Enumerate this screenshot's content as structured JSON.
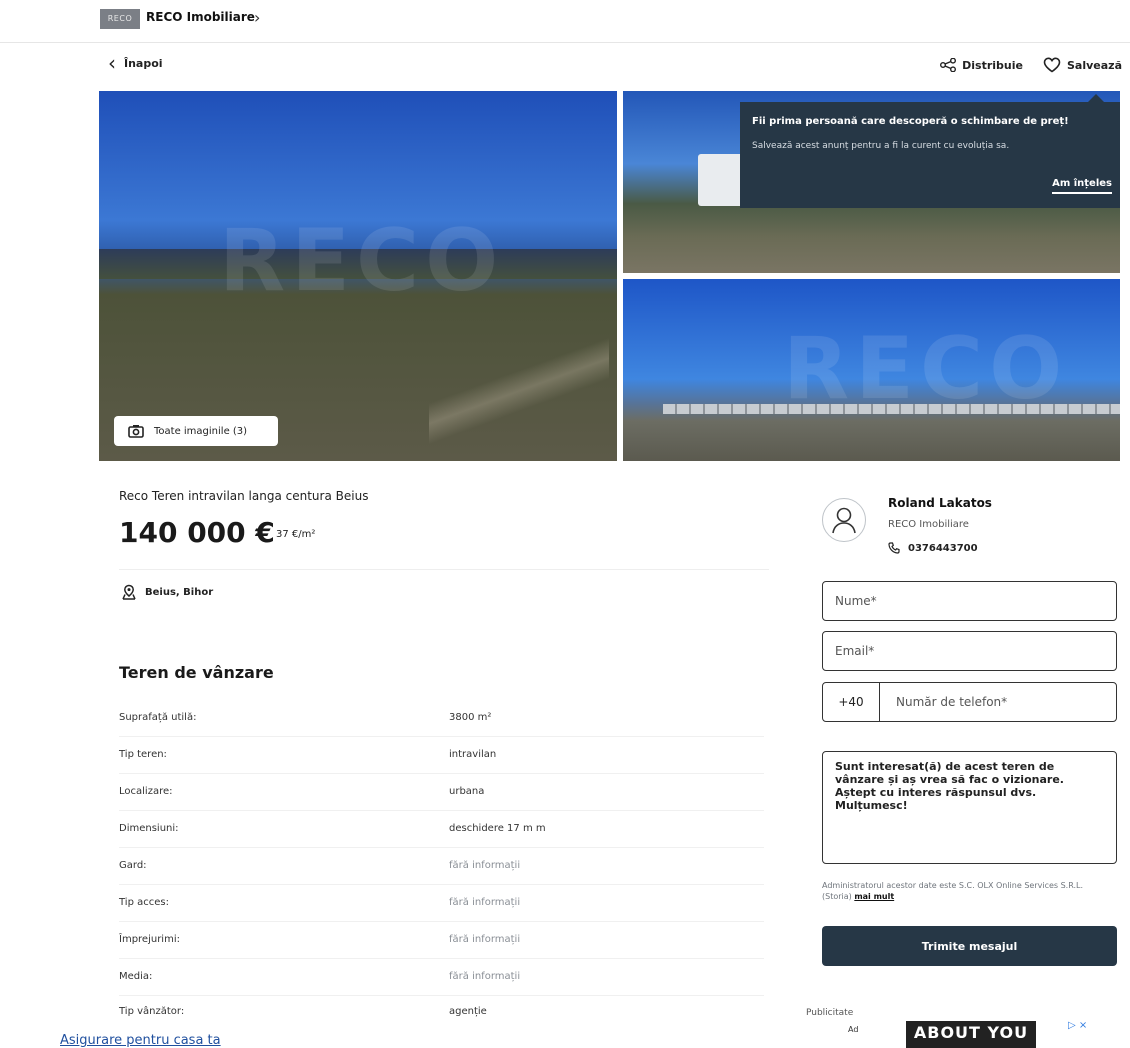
{
  "header": {
    "logo_text": "RECO",
    "brand": "RECO Imobiliare",
    "chevron": "›"
  },
  "nav": {
    "back_label": "Înapoi",
    "share_label": "Distribuie",
    "save_label": "Salvează"
  },
  "gallery": {
    "watermark": "RECO",
    "all_photos_label": "Toate imaginile (3)"
  },
  "tooltip": {
    "title": "Fii prima persoană care descoperă o schimbare de preț!",
    "body": "Salvează acest anunț pentru a fi la curent cu evoluția sa.",
    "button": "Am înțeles"
  },
  "listing": {
    "title": "Reco Teren intravilan langa centura Beius",
    "price": "140 000 €",
    "price_per_m2": "37 €/m²",
    "location": "Beius, Bihor",
    "section_title": "Teren de vânzare",
    "specs": [
      {
        "label": "Suprafață utilă:",
        "value": "3800 m²",
        "muted": false
      },
      {
        "label": "Tip teren:",
        "value": "intravilan",
        "muted": false
      },
      {
        "label": "Localizare:",
        "value": "urbana",
        "muted": false
      },
      {
        "label": "Dimensiuni:",
        "value": "deschidere 17 m m",
        "muted": false
      },
      {
        "label": "Gard:",
        "value": "fără informații",
        "muted": true
      },
      {
        "label": "Tip acces:",
        "value": "fără informații",
        "muted": true
      },
      {
        "label": "Împrejurimi:",
        "value": "fără informații",
        "muted": true
      },
      {
        "label": "Media:",
        "value": "fără informații",
        "muted": true
      },
      {
        "label": "Tip vânzător:",
        "value": "agenție",
        "muted": false
      }
    ]
  },
  "contact": {
    "agent_name": "Roland Lakatos",
    "agency": "RECO Imobiliare",
    "phone": "0376443700",
    "name_placeholder": "Nume*",
    "email_placeholder": "Email*",
    "country_code": "+40",
    "phone_placeholder": "Număr de telefon*",
    "message": "Sunt interesat(ă) de acest teren de vânzare și aș vrea să fac o vizionare. Aștept cu interes răspunsul dvs. Mulțumesc!",
    "disclaimer": "Administratorul acestor date este S.C. OLX Online Services S.R.L. (Storia)",
    "disclaimer_link": "mai mult",
    "send_label": "Trimite mesajul"
  },
  "ad": {
    "published_label": "Publicitate",
    "ad_label": "Ad",
    "banner_text": "ABOUT YOU",
    "close": "▷ ×"
  },
  "footer": {
    "text1": "Asigurare pentru casa ta"
  },
  "colors": {
    "dark_navy": "#263746",
    "accent_blue": "#2f7be0"
  }
}
